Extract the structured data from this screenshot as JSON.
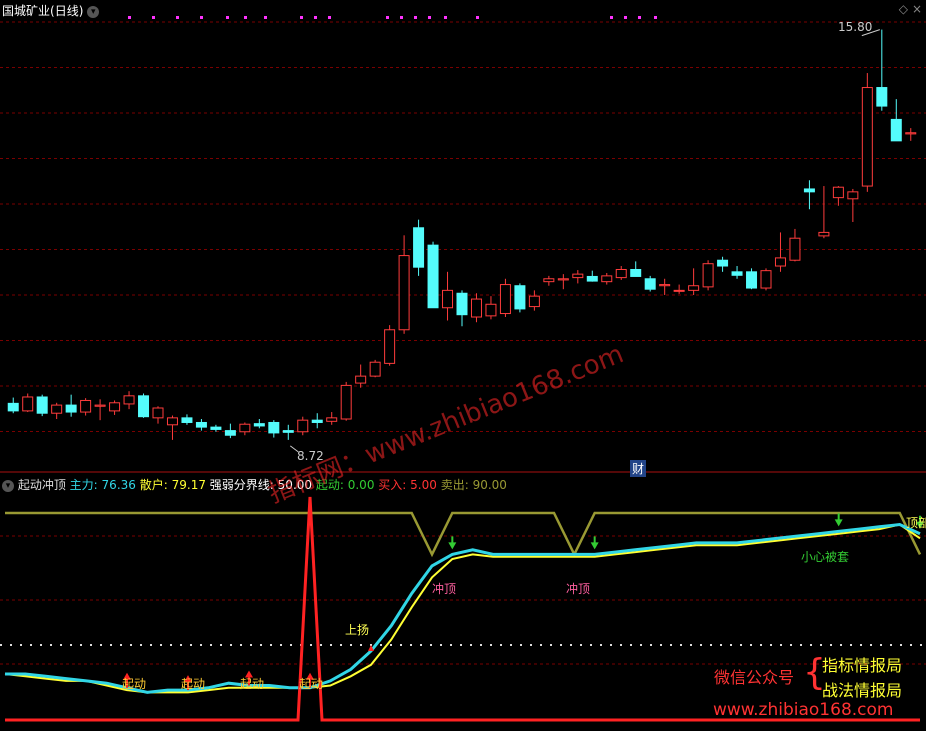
{
  "header": {
    "stock_title": "国城矿业",
    "period": "(日线)",
    "period_button_icon": "chevron-down-icon",
    "corner_icon": "diamond-icon"
  },
  "price_panel": {
    "high_label": "15.80",
    "low_label": "8.72",
    "finance_badge": "财"
  },
  "indicator_panel": {
    "name": "起动冲顶",
    "legend": [
      {
        "label": "主力:",
        "value": "76.36",
        "color": "#31d6e6"
      },
      {
        "label": "散户:",
        "value": "79.17",
        "color": "#ffff33"
      },
      {
        "label": "强弱分界线:",
        "value": "50.00",
        "color": "#ffffff"
      },
      {
        "label": "起动:",
        "value": "0.00",
        "color": "#33cc33"
      },
      {
        "label": "买入:",
        "value": "5.00",
        "color": "#ff3333"
      },
      {
        "label": "卖出:",
        "value": "90.00",
        "color": "#999933"
      }
    ],
    "annotations": {
      "start": "起动",
      "rise": "上扬",
      "top": "冲顶",
      "caution": "小心被套",
      "top_cut": "顶部"
    }
  },
  "watermark": {
    "diagonal": "指标网：www.zhibiao168.com",
    "bottom_url": "www.zhibiao168.com"
  },
  "promo": {
    "wechat": "微信公众号",
    "brace": "{",
    "line1": "指标情报局",
    "line2": "战法情报局"
  },
  "colors": {
    "up": "#ff3c3c",
    "down": "#54fcfc",
    "grid": "#7a0000",
    "main_line": "#31d6e6",
    "retail_line": "#ffff33",
    "sell_line": "#999933",
    "buy_line": "#ff2222"
  },
  "chart_data": [
    {
      "type": "candlestick",
      "series": [
        {
          "name": "",
          "ohlc": [
            [
              9.35,
              9.45,
              9.18,
              9.22
            ],
            [
              9.22,
              9.52,
              9.2,
              9.46
            ],
            [
              9.46,
              9.5,
              9.13,
              9.18
            ],
            [
              9.18,
              9.36,
              9.08,
              9.32
            ],
            [
              9.32,
              9.5,
              9.12,
              9.2
            ],
            [
              9.2,
              9.44,
              9.14,
              9.4
            ],
            [
              9.3,
              9.42,
              9.06,
              9.32
            ],
            [
              9.22,
              9.4,
              9.15,
              9.36
            ],
            [
              9.34,
              9.56,
              9.25,
              9.48
            ],
            [
              9.48,
              9.52,
              9.1,
              9.12
            ],
            [
              9.1,
              9.3,
              9.0,
              9.27
            ],
            [
              8.98,
              9.14,
              8.72,
              9.1
            ],
            [
              9.1,
              9.16,
              8.98,
              9.02
            ],
            [
              9.02,
              9.08,
              8.88,
              8.94
            ],
            [
              8.94,
              8.98,
              8.86,
              8.9
            ],
            [
              8.88,
              9.0,
              8.75,
              8.8
            ],
            [
              8.86,
              9.02,
              8.8,
              8.99
            ],
            [
              9.0,
              9.08,
              8.92,
              8.96
            ],
            [
              9.02,
              9.06,
              8.76,
              8.84
            ],
            [
              8.88,
              8.98,
              8.72,
              8.85
            ],
            [
              8.86,
              9.12,
              8.8,
              9.06
            ],
            [
              9.06,
              9.18,
              8.92,
              9.02
            ],
            [
              9.04,
              9.2,
              8.98,
              9.1
            ],
            [
              9.08,
              9.72,
              9.05,
              9.66
            ],
            [
              9.7,
              10.02,
              9.62,
              9.82
            ],
            [
              9.82,
              10.1,
              9.8,
              10.06
            ],
            [
              10.04,
              10.7,
              10.0,
              10.62
            ],
            [
              10.62,
              12.25,
              10.55,
              11.9
            ],
            [
              12.38,
              12.52,
              11.55,
              11.7
            ],
            [
              12.08,
              12.14,
              11.0,
              11.0
            ],
            [
              11.0,
              11.62,
              10.78,
              11.3
            ],
            [
              11.25,
              11.3,
              10.68,
              10.88
            ],
            [
              10.84,
              11.25,
              10.75,
              11.15
            ],
            [
              10.86,
              11.2,
              10.8,
              11.06
            ],
            [
              10.9,
              11.5,
              10.84,
              11.4
            ],
            [
              11.38,
              11.42,
              10.92,
              10.98
            ],
            [
              11.02,
              11.3,
              10.95,
              11.2
            ],
            [
              11.45,
              11.55,
              11.38,
              11.5
            ],
            [
              11.48,
              11.58,
              11.32,
              11.5
            ],
            [
              11.52,
              11.65,
              11.42,
              11.58
            ],
            [
              11.54,
              11.64,
              11.45,
              11.46
            ],
            [
              11.45,
              11.6,
              11.4,
              11.55
            ],
            [
              11.52,
              11.72,
              11.48,
              11.66
            ],
            [
              11.66,
              11.8,
              11.56,
              11.54
            ],
            [
              11.5,
              11.55,
              11.28,
              11.32
            ],
            [
              11.38,
              11.5,
              11.22,
              11.4
            ],
            [
              11.3,
              11.4,
              11.24,
              11.3
            ],
            [
              11.3,
              11.68,
              11.22,
              11.38
            ],
            [
              11.36,
              11.82,
              11.3,
              11.76
            ],
            [
              11.82,
              11.88,
              11.62,
              11.72
            ],
            [
              11.62,
              11.72,
              11.5,
              11.56
            ],
            [
              11.62,
              11.68,
              11.32,
              11.34
            ],
            [
              11.34,
              11.68,
              11.3,
              11.64
            ],
            [
              11.72,
              12.3,
              11.62,
              11.86
            ],
            [
              11.82,
              12.36,
              11.8,
              12.2
            ],
            [
              13.05,
              13.2,
              12.7,
              13.0
            ],
            [
              12.24,
              13.1,
              12.2,
              12.3
            ],
            [
              12.9,
              13.1,
              12.76,
              13.08
            ],
            [
              12.88,
              13.05,
              12.48,
              13.0
            ],
            [
              13.1,
              15.05,
              13.0,
              14.8
            ],
            [
              14.8,
              15.8,
              14.4,
              14.48
            ],
            [
              14.25,
              14.6,
              13.9,
              13.88
            ],
            [
              14.0,
              14.1,
              13.88,
              14.02
            ]
          ]
        }
      ],
      "annotations": [
        "15.80",
        "8.72"
      ],
      "grid": true
    },
    {
      "type": "line",
      "title": "起动冲顶",
      "ylim": [
        0,
        100
      ],
      "series": [
        {
          "name": "主力",
          "values": [
            20,
            20,
            19,
            18,
            17,
            16,
            14,
            12,
            13,
            13,
            14,
            16,
            15,
            15,
            14,
            14,
            17,
            22,
            30,
            41,
            55,
            67,
            72,
            74,
            72,
            72,
            72,
            72,
            72,
            72,
            73,
            74,
            75,
            76,
            77,
            77,
            77,
            78,
            79,
            80,
            81,
            82,
            83,
            84,
            85,
            81
          ]
        },
        {
          "name": "散户",
          "values": [
            20,
            19,
            18,
            17,
            17,
            15,
            13,
            12,
            12,
            12,
            13,
            14,
            14,
            14,
            14,
            14,
            15,
            19,
            24,
            35,
            49,
            62,
            70,
            72,
            71,
            71,
            71,
            71,
            71,
            71,
            72,
            73,
            74,
            75,
            76,
            76,
            76,
            77,
            78,
            79,
            80,
            81,
            82,
            83,
            85,
            79
          ]
        },
        {
          "name": "强弱分界线",
          "values": [
            50
          ]
        },
        {
          "name": "买入",
          "values": [
            0,
            0,
            0,
            0,
            0,
            0,
            0,
            0,
            0,
            0,
            0,
            0,
            0,
            0,
            0,
            100,
            0,
            0,
            0,
            0,
            0,
            0,
            0,
            0,
            0,
            0,
            0,
            0,
            0,
            0,
            0,
            0,
            0,
            0,
            0,
            0,
            0,
            0,
            0,
            0,
            0,
            0,
            0,
            0,
            0,
            0
          ]
        },
        {
          "name": "卖出",
          "values": [
            90,
            90,
            90,
            90,
            90,
            90,
            90,
            90,
            90,
            90,
            90,
            90,
            90,
            90,
            90,
            90,
            90,
            90,
            90,
            90,
            90,
            72,
            90,
            90,
            90,
            90,
            90,
            90,
            72,
            90,
            90,
            90,
            90,
            90,
            90,
            90,
            90,
            90,
            90,
            90,
            90,
            90,
            90,
            90,
            90,
            72
          ]
        }
      ],
      "signals": {
        "start": [
          6,
          9,
          12,
          15
        ],
        "rise": [
          18
        ],
        "top": [
          22,
          29,
          41,
          45
        ]
      }
    }
  ]
}
